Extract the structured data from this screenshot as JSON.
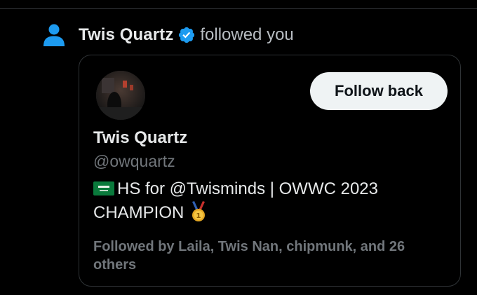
{
  "notification": {
    "name": "Twis Quartz",
    "action": "followed you",
    "icon": "person-icon",
    "icon_color": "#1d9bf0",
    "verified_icon": "verified-badge-icon"
  },
  "card": {
    "follow_button_label": "Follow back",
    "display_name": "Twis Quartz",
    "handle": "@owquartz",
    "bio_line1": "HS for @Twisminds | OWWC 2023",
    "bio_line2": "CHAMPION",
    "bio_flag_icon": "saudi-flag-icon",
    "bio_medal_icon": "gold-medal-icon",
    "followed_by": "Followed by Laila, Twis Nan, chipmunk, and 26 others"
  },
  "colors": {
    "background": "#000000",
    "text_primary": "#e7e9ea",
    "text_secondary": "#71767b",
    "accent": "#1d9bf0",
    "button_bg": "#eff3f4",
    "button_text": "#0f1419"
  }
}
